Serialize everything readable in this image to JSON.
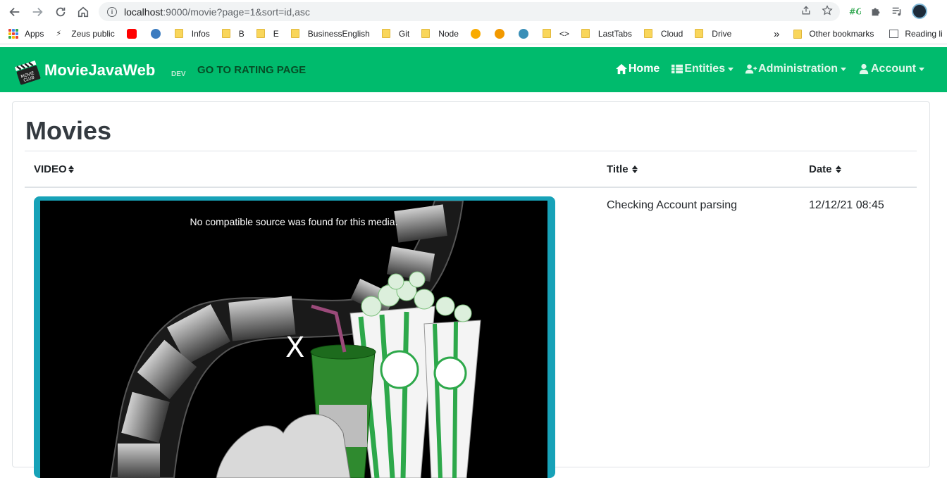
{
  "browser": {
    "url_host": "localhost",
    "url_path": ":9000/movie?page=1&sort=id,asc",
    "bookmarks": [
      {
        "label": "Apps",
        "icon": "apps-grid-icon"
      },
      {
        "label": "Zeus public",
        "icon": "bolt-icon"
      },
      {
        "label": "",
        "icon": "youtube-icon"
      },
      {
        "label": "",
        "icon": "bird-icon"
      },
      {
        "label": "Infos",
        "icon": "folder-icon"
      },
      {
        "label": "B",
        "icon": "folder-icon"
      },
      {
        "label": "E",
        "icon": "folder-icon"
      },
      {
        "label": "BusinessEnglish",
        "icon": "folder-icon"
      },
      {
        "label": "Git",
        "icon": "folder-icon"
      },
      {
        "label": "Node",
        "icon": "folder-icon"
      },
      {
        "label": "",
        "icon": "orange-app-icon"
      },
      {
        "label": "",
        "icon": "d-circle-icon"
      },
      {
        "label": "",
        "icon": "globe-icon"
      },
      {
        "label": "<>",
        "icon": "folder-icon"
      },
      {
        "label": "LastTabs",
        "icon": "folder-icon"
      },
      {
        "label": "Cloud",
        "icon": "folder-icon"
      },
      {
        "label": "Drive",
        "icon": "folder-icon"
      }
    ],
    "overflow_label": "»",
    "other_bookmarks": "Other bookmarks",
    "reading_list": "Reading li"
  },
  "app": {
    "brand": "MovieJavaWeb",
    "env": "DEV",
    "rating_link": "GO TO RATING PAGE",
    "nav": {
      "home": "Home",
      "entities": "Entities",
      "administration": "Administration",
      "account": "Account"
    },
    "colors": {
      "navbar": "#00bb6d",
      "video_border": "#17a2b8"
    }
  },
  "page": {
    "title": "Movies",
    "columns": {
      "video": "VIDEO",
      "title": "Title",
      "date": "Date"
    },
    "rows": [
      {
        "video_error": "No compatible source was found for this media.",
        "video_close": "X",
        "title": "Checking Account parsing",
        "date": "12/12/21 08:45"
      }
    ]
  }
}
